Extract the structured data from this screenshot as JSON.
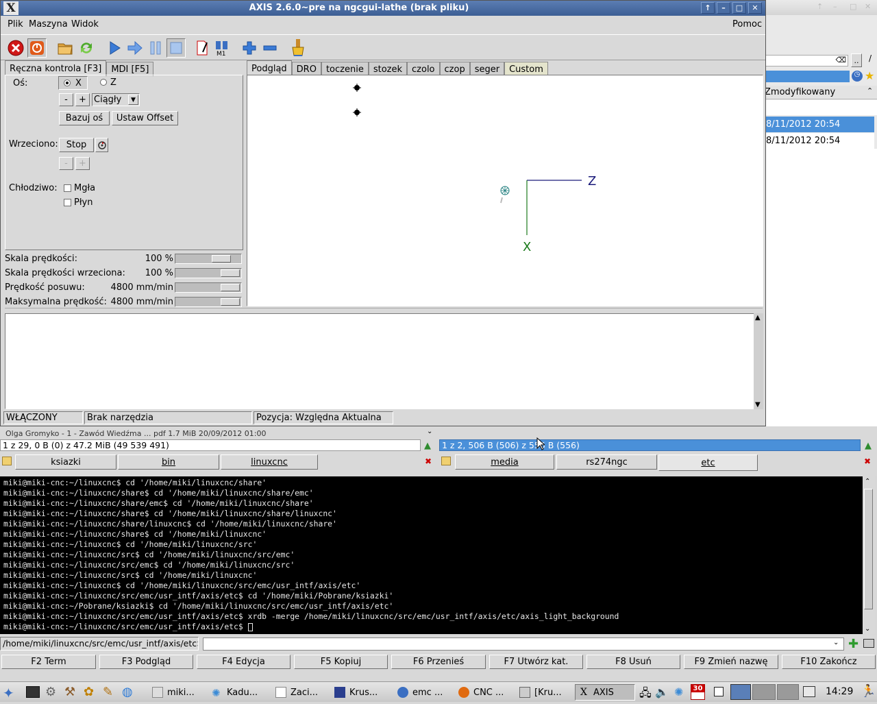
{
  "window": {
    "title": "AXIS 2.6.0~pre na ngcgui-lathe (brak pliku)"
  },
  "menu": {
    "file": "Plik",
    "machine": "Maszyna",
    "view": "Widok",
    "help": "Pomoc"
  },
  "left_tabs": [
    "Ręczna kontrola [F3]",
    "MDI [F5]"
  ],
  "manual": {
    "axis_label": "Oś:",
    "axis_x": "X",
    "axis_z": "Z",
    "minus": "-",
    "plus": "+",
    "jog_mode": "Ciągły",
    "home_button": "Bazuj oś",
    "offset_button": "Ustaw Offset",
    "spindle_label": "Wrzeciono:",
    "spindle_stop": "Stop",
    "coolant_label": "Chłodziwo:",
    "mist": "Mgła",
    "flood": "Płyn"
  },
  "overrides": [
    {
      "label": "Skala prędkości:",
      "value": "100 %",
      "level": 0.8
    },
    {
      "label": "Skala prędkości wrzeciona:",
      "value": "100 %",
      "level": 1.0
    },
    {
      "label": "Prędkość posuwu:",
      "value": "4800 mm/min",
      "level": 1.0
    },
    {
      "label": "Maksymalna prędkość:",
      "value": "4800 mm/min",
      "level": 1.0
    }
  ],
  "right_tabs": [
    "Podgląd",
    "DRO",
    "toczenie",
    "stozek",
    "czolo",
    "czop",
    "seger",
    "Custom"
  ],
  "preview": {
    "axis_z": "Z",
    "axis_x": "X"
  },
  "status": {
    "state": "WŁĄCZONY",
    "tool": "Brak narzędzia",
    "position": "Pozycja: Względna Aktualna"
  },
  "bg_window": {
    "column": "Zmodyfikowany",
    "row1": "8/11/2012 20:54",
    "row2": "8/11/2012 20:54",
    "dots": ".."
  },
  "panels": {
    "left_info": "1 z 29, 0 B (0) z 47.2 MiB (49 539 491)",
    "right_info": "1 z 2, 506 B (506) z 556 B (556)",
    "left_tabs": [
      "ksiazki",
      "bin",
      "linuxcnc"
    ],
    "right_tabs": [
      "media",
      "rs274ngc",
      "etc"
    ],
    "hidden_row": "Olga Gromyko - 1 - Zawód Wiedźma ... pdf    1.7 MiB  20/09/2012 01:00"
  },
  "terminal_lines": [
    "miki@miki-cnc:~/linuxcnc$ cd '/home/miki/linuxcnc/share'",
    "miki@miki-cnc:~/linuxcnc/share$ cd '/home/miki/linuxcnc/share/emc'",
    "miki@miki-cnc:~/linuxcnc/share/emc$ cd '/home/miki/linuxcnc/share'",
    "miki@miki-cnc:~/linuxcnc/share$ cd '/home/miki/linuxcnc/share/linuxcnc'",
    "miki@miki-cnc:~/linuxcnc/share/linuxcnc$ cd '/home/miki/linuxcnc/share'",
    "miki@miki-cnc:~/linuxcnc/share$ cd '/home/miki/linuxcnc'",
    "miki@miki-cnc:~/linuxcnc$ cd '/home/miki/linuxcnc/src'",
    "miki@miki-cnc:~/linuxcnc/src$ cd '/home/miki/linuxcnc/src/emc'",
    "miki@miki-cnc:~/linuxcnc/src/emc$ cd '/home/miki/linuxcnc/src'",
    "miki@miki-cnc:~/linuxcnc/src$ cd '/home/miki/linuxcnc'",
    "miki@miki-cnc:~/linuxcnc$ cd '/home/miki/linuxcnc/src/emc/usr_intf/axis/etc'",
    "miki@miki-cnc:~/linuxcnc/src/emc/usr_intf/axis/etc$ cd '/home/miki/Pobrane/ksiazki'",
    "miki@miki-cnc:~/Pobrane/ksiazki$ cd '/home/miki/linuxcnc/src/emc/usr_intf/axis/etc'",
    "miki@miki-cnc:~/linuxcnc/src/emc/usr_intf/axis/etc$ xrdb -merge /home/miki/linuxcnc/src/emc/usr_intf/axis/etc/axis_light_background",
    "miki@miki-cnc:~/linuxcnc/src/emc/usr_intf/axis/etc$ "
  ],
  "cmdline": {
    "path": "/home/miki/linuxcnc/src/emc/usr_intf/axis/etc>",
    "value": ""
  },
  "fkeys": [
    "F2 Term",
    "F3 Podgląd",
    "F4 Edycja",
    "F5 Kopiuj",
    "F6 Przenieś",
    "F7 Utwórz kat.",
    "F8 Usuń",
    "F9 Zmień nazwę",
    "F10 Zakończ"
  ],
  "taskbar": {
    "tasks": [
      "miki...",
      "Kadu...",
      "Zaci...",
      "Krus...",
      "emc ...",
      "CNC ...",
      "[Kru...",
      "AXIS"
    ],
    "date_badge": "30",
    "clock": "14:29"
  },
  "colors": {
    "title": "#3d5f94",
    "selection": "#4a90d9",
    "terminal_bg": "#000000",
    "estop": "#d01818",
    "preview_axes": "#1a1a7a"
  }
}
